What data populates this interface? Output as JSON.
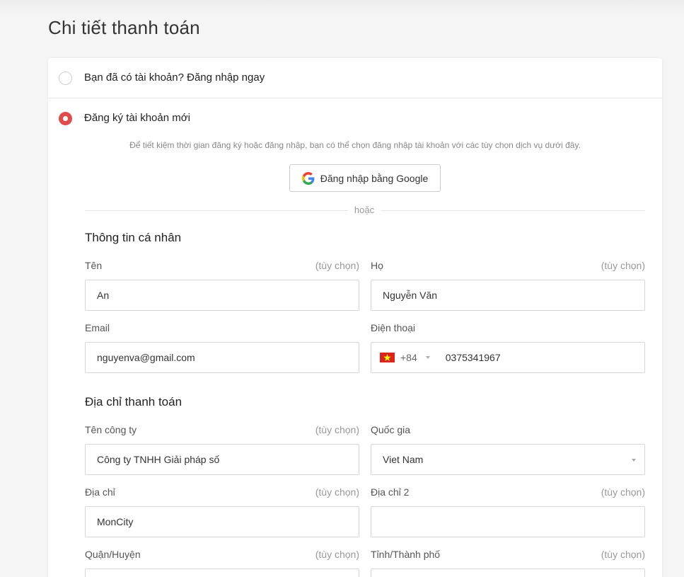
{
  "page": {
    "title": "Chi tiết thanh toán"
  },
  "account": {
    "login_label": "Bạn đã có tài khoản? Đăng nhập ngay",
    "register_label": "Đăng ký tài khoản mới",
    "selected": "register",
    "social_note": "Để tiết kiệm thời gian đăng ký hoặc đăng nhập, bạn có thể chọn đăng nhập tài khoản với các tùy chọn dịch vụ dưới đây.",
    "google_button": "Đăng nhập bằng Google",
    "divider": "hoặc"
  },
  "personal": {
    "title": "Thông tin cá nhân",
    "first_name": {
      "label": "Tên",
      "optional": "(tùy chọn)",
      "value": "An"
    },
    "last_name": {
      "label": "Họ",
      "optional": "(tùy chọn)",
      "value": "Nguyễn Văn"
    },
    "email": {
      "label": "Email",
      "value": "nguyenva@gmail.com"
    },
    "phone": {
      "label": "Điện thoại",
      "dial_code": "+84",
      "value": "0375341967",
      "flag": "vietnam-flag-icon"
    }
  },
  "billing": {
    "title": "Địa chỉ thanh toán",
    "company": {
      "label": "Tên công ty",
      "optional": "(tùy chọn)",
      "value": "Công ty TNHH Giải pháp số"
    },
    "country": {
      "label": "Quốc gia",
      "value": "Viet Nam"
    },
    "address": {
      "label": "Địa chỉ",
      "optional": "(tùy chọn)",
      "value": "MonCity"
    },
    "address2": {
      "label": "Địa chỉ 2",
      "optional": "(tùy chọn)",
      "value": ""
    },
    "district": {
      "label": "Quận/Huyện",
      "optional": "(tùy chọn)",
      "value": ""
    },
    "city": {
      "label": "Tỉnh/Thành phố",
      "optional": "(tùy chọn)",
      "value": ""
    }
  },
  "colors": {
    "accent": "#e04b4b",
    "border": "#d6d6d6",
    "muted": "#999999"
  }
}
